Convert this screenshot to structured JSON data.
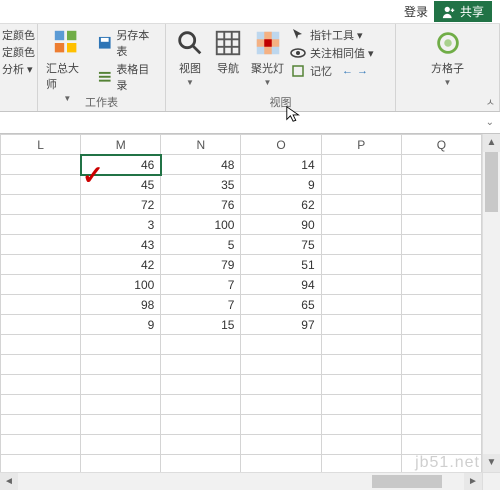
{
  "titlebar": {
    "login": "登录",
    "share": "共享"
  },
  "ribbon": {
    "left_items": [
      "定颜色",
      "定颜色",
      "分析 ▾"
    ],
    "groups": {
      "worksheet": {
        "label": "工作表",
        "summary": "汇总大师",
        "saveas_table": "另存本表",
        "table_toc": "表格目录"
      },
      "view": {
        "label": "视图",
        "view_btn": "视图",
        "nav_btn": "导航",
        "spotlight_btn": "聚光灯",
        "pointer_tool": "指针工具 ▾",
        "focus_same": "关注相同值 ▾",
        "memory": "记忆"
      },
      "fangge": {
        "label": "方格子"
      }
    },
    "nav_arrows": {
      "left": "←",
      "right": "→"
    }
  },
  "grid": {
    "columns": [
      "L",
      "M",
      "N",
      "O",
      "P",
      "Q"
    ],
    "selected_cell": "M1",
    "rows": [
      {
        "M": 46,
        "N": 48,
        "O": 14
      },
      {
        "M": 45,
        "N": 35,
        "O": 9
      },
      {
        "M": 72,
        "N": 76,
        "O": 62
      },
      {
        "M": 3,
        "N": 100,
        "O": 90
      },
      {
        "M": 43,
        "N": 5,
        "O": 75
      },
      {
        "M": 42,
        "N": 79,
        "O": 51
      },
      {
        "M": 100,
        "N": 7,
        "O": 94
      },
      {
        "M": 98,
        "N": 7,
        "O": 65
      },
      {
        "M": 9,
        "N": 15,
        "O": 97
      }
    ]
  },
  "watermark": "jb51.net",
  "annotation": {
    "checkmark": "✓"
  }
}
